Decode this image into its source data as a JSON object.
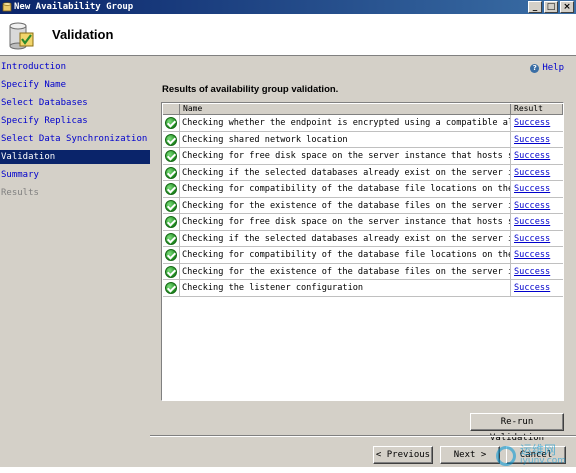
{
  "window": {
    "title": "New Availability Group",
    "minimize": "_",
    "maximize": "□",
    "close": "×"
  },
  "header": {
    "title": "Validation"
  },
  "sidebar": {
    "items": [
      {
        "label": "Introduction",
        "state": "link"
      },
      {
        "label": "Specify Name",
        "state": "link"
      },
      {
        "label": "Select Databases",
        "state": "link"
      },
      {
        "label": "Specify Replicas",
        "state": "link"
      },
      {
        "label": "Select Data Synchronization",
        "state": "link"
      },
      {
        "label": "Validation",
        "state": "active"
      },
      {
        "label": "Summary",
        "state": "link"
      },
      {
        "label": "Results",
        "state": "disabled"
      }
    ]
  },
  "main": {
    "help_label": "Help",
    "heading": "Results of availability group validation.",
    "columns": {
      "name": "Name",
      "result": "Result"
    },
    "rows": [
      {
        "name": "Checking whether the endpoint is encrypted using a compatible al...",
        "result": "Success"
      },
      {
        "name": "Checking shared network location",
        "result": "Success"
      },
      {
        "name": "Checking for free disk space on the server instance that hosts s...",
        "result": "Success"
      },
      {
        "name": "Checking if the selected databases already exist on the server i...",
        "result": "Success"
      },
      {
        "name": "Checking for compatibility of the database file locations on the...",
        "result": "Success"
      },
      {
        "name": "Checking for the existence of the database files on the server i...",
        "result": "Success"
      },
      {
        "name": "Checking for free disk space on the server instance that hosts s...",
        "result": "Success"
      },
      {
        "name": "Checking if the selected databases already exist on the server i...",
        "result": "Success"
      },
      {
        "name": "Checking for compatibility of the database file locations on the...",
        "result": "Success"
      },
      {
        "name": "Checking for the existence of the database files on the server i...",
        "result": "Success"
      },
      {
        "name": "Checking the listener configuration",
        "result": "Success"
      }
    ],
    "rerun_label": "Re-run Validation"
  },
  "footer": {
    "previous_label": "< Previous",
    "next_label": "Next >",
    "cancel_label": "Cancel"
  },
  "watermark": {
    "text_cn": "运维网",
    "url": "iyunv.com"
  },
  "colors": {
    "title_bar": "#0a246a",
    "link": "#0000cc",
    "active_item": "#0a246a",
    "success_icon": "#1f8a1f",
    "watermark": "#0096d6"
  }
}
